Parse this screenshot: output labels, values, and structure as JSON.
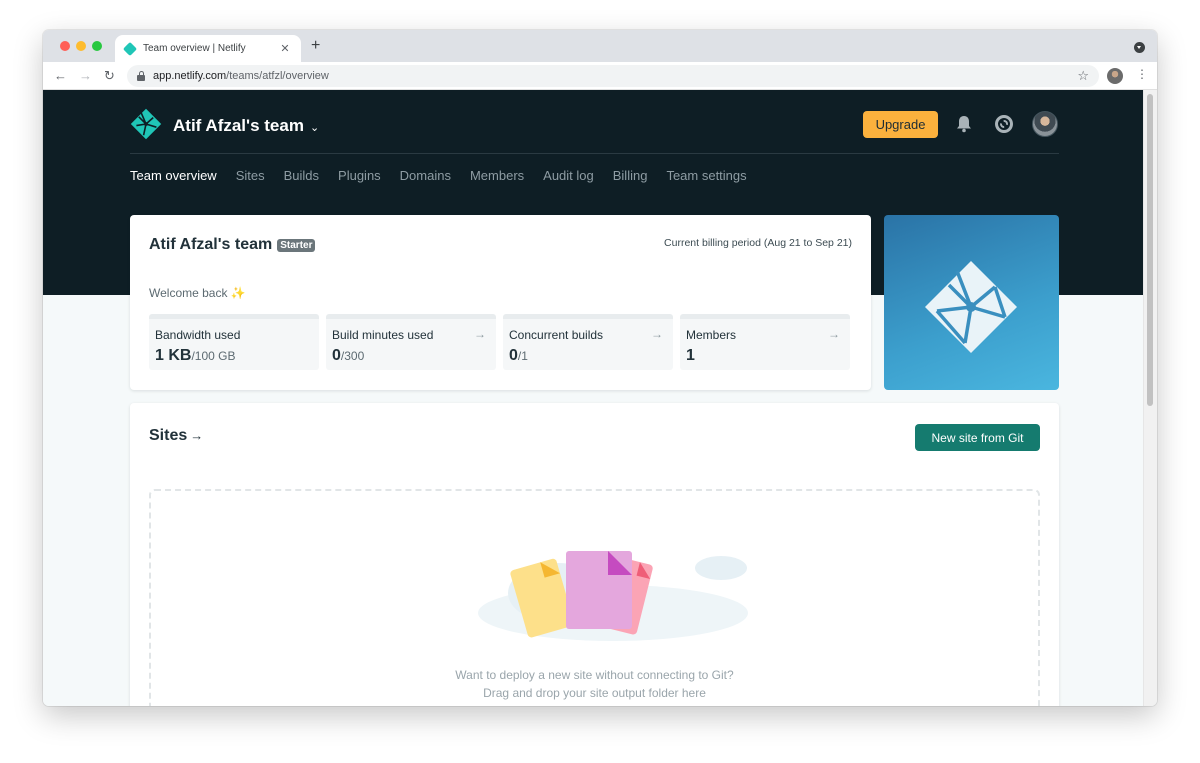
{
  "browser": {
    "tab_title": "Team overview | Netlify",
    "tab_close": "✕",
    "new_tab": "+",
    "url_host": "app.netlify.com",
    "url_path": "/teams/atfzl/overview"
  },
  "header": {
    "team_name": "Atif Afzal's team",
    "upgrade_label": "Upgrade",
    "nav": [
      {
        "label": "Team overview",
        "active": true
      },
      {
        "label": "Sites"
      },
      {
        "label": "Builds"
      },
      {
        "label": "Plugins"
      },
      {
        "label": "Domains"
      },
      {
        "label": "Members"
      },
      {
        "label": "Audit log"
      },
      {
        "label": "Billing"
      },
      {
        "label": "Team settings"
      }
    ]
  },
  "team_card": {
    "title": "Atif Afzal's team",
    "plan": "Starter",
    "billing_period": "Current billing period (Aug 21 to Sep 21)",
    "welcome": "Welcome back",
    "welcome_emoji": "✨",
    "stats": [
      {
        "label": "Bandwidth used",
        "value": "1 KB",
        "limit": "/100 GB",
        "arrow": ""
      },
      {
        "label": "Build minutes used",
        "value": "0",
        "limit": "/300",
        "arrow": "→"
      },
      {
        "label": "Concurrent builds",
        "value": "0",
        "limit": "/1",
        "arrow": "→"
      },
      {
        "label": "Members",
        "value": "1",
        "limit": "",
        "arrow": "→"
      }
    ]
  },
  "sites": {
    "title": "Sites",
    "title_arrow": "→",
    "new_site_label": "New site from Git",
    "drop_line1": "Want to deploy a new site without connecting to Git?",
    "drop_line2": "Drag and drop your site output folder here"
  },
  "colors": {
    "header_bg": "#0e1e25",
    "upgrade": "#fbb13d",
    "primary_button": "#157b6f",
    "brand_teal": "#20c6b7"
  }
}
